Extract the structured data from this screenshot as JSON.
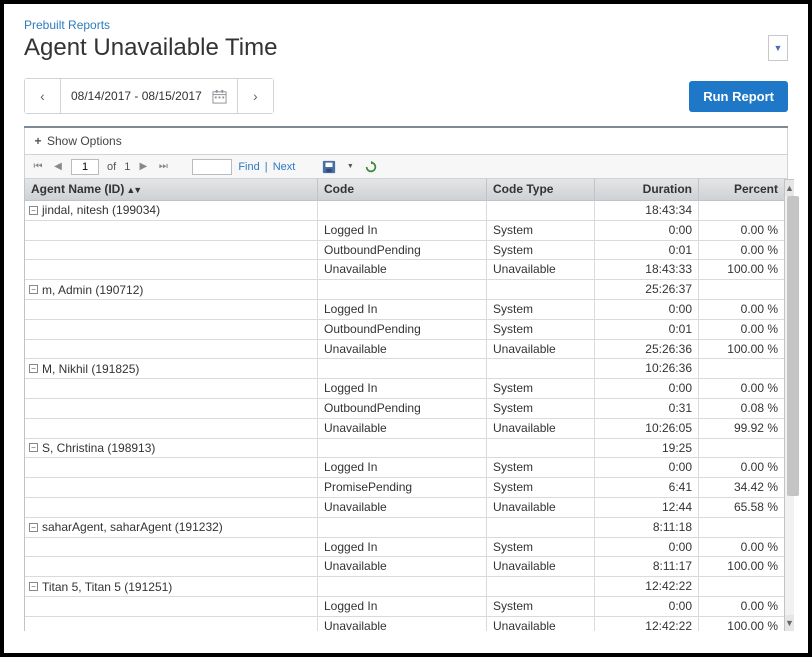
{
  "breadcrumb": "Prebuilt Reports",
  "title": "Agent Unavailable Time",
  "dateRange": "08/14/2017 - 08/15/2017",
  "runButton": "Run Report",
  "showOptions": "Show Options",
  "pager": {
    "current": "1",
    "ofLabel": "of",
    "total": "1",
    "find": "Find",
    "next": "Next"
  },
  "columns": {
    "agent": "Agent Name (ID)",
    "code": "Code",
    "type": "Code Type",
    "duration": "Duration",
    "percent": "Percent"
  },
  "groups": [
    {
      "agent": "jindal, nitesh (199034)",
      "duration": "18:43:34",
      "rows": [
        {
          "code": "Logged In",
          "type": "System",
          "duration": "0:00",
          "percent": "0.00 %"
        },
        {
          "code": "OutboundPending",
          "type": "System",
          "duration": "0:01",
          "percent": "0.00 %"
        },
        {
          "code": "Unavailable",
          "type": "Unavailable",
          "duration": "18:43:33",
          "percent": "100.00 %"
        }
      ]
    },
    {
      "agent": "m, Admin (190712)",
      "duration": "25:26:37",
      "rows": [
        {
          "code": "Logged In",
          "type": "System",
          "duration": "0:00",
          "percent": "0.00 %"
        },
        {
          "code": "OutboundPending",
          "type": "System",
          "duration": "0:01",
          "percent": "0.00 %"
        },
        {
          "code": "Unavailable",
          "type": "Unavailable",
          "duration": "25:26:36",
          "percent": "100.00 %"
        }
      ]
    },
    {
      "agent": "M, Nikhil (191825)",
      "duration": "10:26:36",
      "rows": [
        {
          "code": "Logged In",
          "type": "System",
          "duration": "0:00",
          "percent": "0.00 %"
        },
        {
          "code": "OutboundPending",
          "type": "System",
          "duration": "0:31",
          "percent": "0.08 %"
        },
        {
          "code": "Unavailable",
          "type": "Unavailable",
          "duration": "10:26:05",
          "percent": "99.92 %"
        }
      ]
    },
    {
      "agent": "S, Christina (198913)",
      "duration": "19:25",
      "rows": [
        {
          "code": "Logged In",
          "type": "System",
          "duration": "0:00",
          "percent": "0.00 %"
        },
        {
          "code": "PromisePending",
          "type": "System",
          "duration": "6:41",
          "percent": "34.42 %"
        },
        {
          "code": "Unavailable",
          "type": "Unavailable",
          "duration": "12:44",
          "percent": "65.58 %"
        }
      ]
    },
    {
      "agent": "saharAgent, saharAgent (191232)",
      "duration": "8:11:18",
      "rows": [
        {
          "code": "Logged In",
          "type": "System",
          "duration": "0:00",
          "percent": "0.00 %"
        },
        {
          "code": "Unavailable",
          "type": "Unavailable",
          "duration": "8:11:17",
          "percent": "100.00 %"
        }
      ]
    },
    {
      "agent": "Titan 5, Titan 5 (191251)",
      "duration": "12:42:22",
      "rows": [
        {
          "code": "Logged In",
          "type": "System",
          "duration": "0:00",
          "percent": "0.00 %"
        },
        {
          "code": "Unavailable",
          "type": "Unavailable",
          "duration": "12:42:22",
          "percent": "100.00 %"
        }
      ]
    }
  ]
}
